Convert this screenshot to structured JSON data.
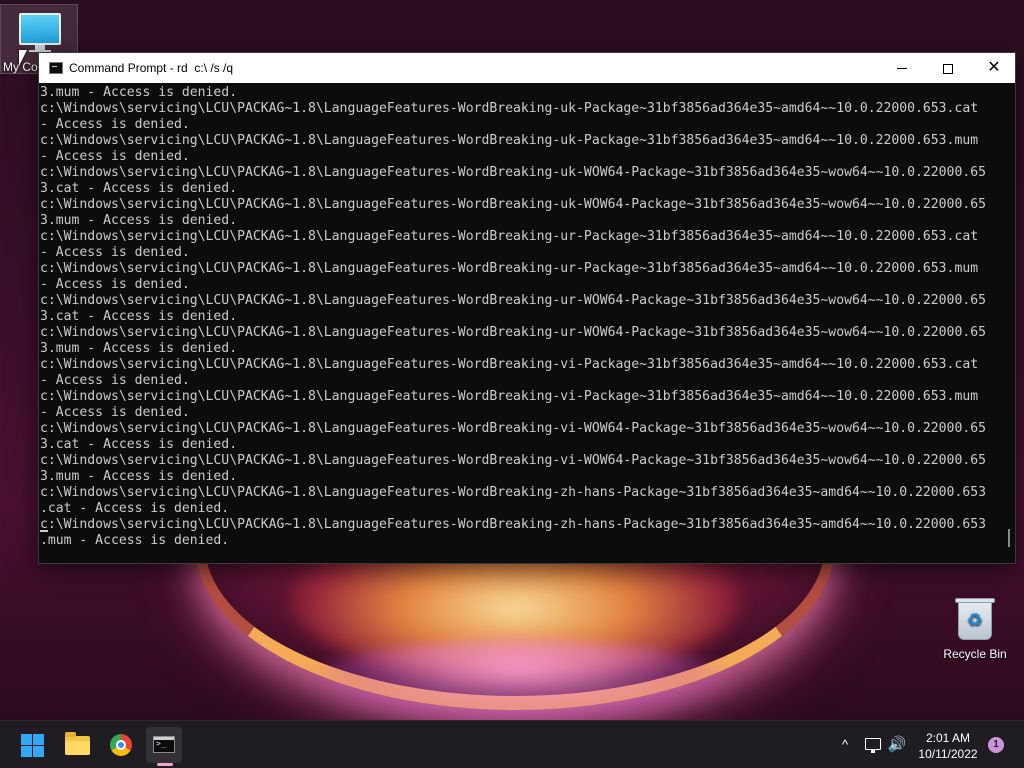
{
  "desktop": {
    "icons": [
      {
        "label": "My Co",
        "icon": "computer-icon"
      },
      {
        "label": "Recycle Bin",
        "icon": "recycle-bin-icon"
      }
    ]
  },
  "window": {
    "title": "Command Prompt - rd  c:\\ /s /q",
    "controls": {
      "minimize": "minimize",
      "maximize": "maximize",
      "close": "close"
    },
    "lines": [
      "3.mum - Access is denied.",
      "c:\\Windows\\servicing\\LCU\\PACKAG~1.8\\LanguageFeatures-WordBreaking-uk-Package~31bf3856ad364e35~amd64~~10.0.22000.653.cat",
      "- Access is denied.",
      "c:\\Windows\\servicing\\LCU\\PACKAG~1.8\\LanguageFeatures-WordBreaking-uk-Package~31bf3856ad364e35~amd64~~10.0.22000.653.mum",
      "- Access is denied.",
      "c:\\Windows\\servicing\\LCU\\PACKAG~1.8\\LanguageFeatures-WordBreaking-uk-WOW64-Package~31bf3856ad364e35~wow64~~10.0.22000.65",
      "3.cat - Access is denied.",
      "c:\\Windows\\servicing\\LCU\\PACKAG~1.8\\LanguageFeatures-WordBreaking-uk-WOW64-Package~31bf3856ad364e35~wow64~~10.0.22000.65",
      "3.mum - Access is denied.",
      "c:\\Windows\\servicing\\LCU\\PACKAG~1.8\\LanguageFeatures-WordBreaking-ur-Package~31bf3856ad364e35~amd64~~10.0.22000.653.cat",
      "- Access is denied.",
      "c:\\Windows\\servicing\\LCU\\PACKAG~1.8\\LanguageFeatures-WordBreaking-ur-Package~31bf3856ad364e35~amd64~~10.0.22000.653.mum",
      "- Access is denied.",
      "c:\\Windows\\servicing\\LCU\\PACKAG~1.8\\LanguageFeatures-WordBreaking-ur-WOW64-Package~31bf3856ad364e35~wow64~~10.0.22000.65",
      "3.cat - Access is denied.",
      "c:\\Windows\\servicing\\LCU\\PACKAG~1.8\\LanguageFeatures-WordBreaking-ur-WOW64-Package~31bf3856ad364e35~wow64~~10.0.22000.65",
      "3.mum - Access is denied.",
      "c:\\Windows\\servicing\\LCU\\PACKAG~1.8\\LanguageFeatures-WordBreaking-vi-Package~31bf3856ad364e35~amd64~~10.0.22000.653.cat",
      "- Access is denied.",
      "c:\\Windows\\servicing\\LCU\\PACKAG~1.8\\LanguageFeatures-WordBreaking-vi-Package~31bf3856ad364e35~amd64~~10.0.22000.653.mum",
      "- Access is denied.",
      "c:\\Windows\\servicing\\LCU\\PACKAG~1.8\\LanguageFeatures-WordBreaking-vi-WOW64-Package~31bf3856ad364e35~wow64~~10.0.22000.65",
      "3.cat - Access is denied.",
      "c:\\Windows\\servicing\\LCU\\PACKAG~1.8\\LanguageFeatures-WordBreaking-vi-WOW64-Package~31bf3856ad364e35~wow64~~10.0.22000.65",
      "3.mum - Access is denied.",
      "c:\\Windows\\servicing\\LCU\\PACKAG~1.8\\LanguageFeatures-WordBreaking-zh-hans-Package~31bf3856ad364e35~amd64~~10.0.22000.653",
      ".cat - Access is denied.",
      "c:\\Windows\\servicing\\LCU\\PACKAG~1.8\\LanguageFeatures-WordBreaking-zh-hans-Package~31bf3856ad364e35~amd64~~10.0.22000.653",
      ".mum - Access is denied."
    ]
  },
  "taskbar": {
    "apps": [
      {
        "name": "Start",
        "icon": "windows-logo-icon"
      },
      {
        "name": "File Explorer",
        "icon": "folder-icon"
      },
      {
        "name": "Google Chrome",
        "icon": "chrome-icon"
      },
      {
        "name": "Command Prompt",
        "icon": "terminal-icon",
        "active": true
      }
    ],
    "tray": {
      "chevron": "^",
      "volume_glyph": "🔊",
      "time": "2:01 AM",
      "date": "10/11/2022",
      "notifications": "1"
    }
  },
  "colors": {
    "console_bg": "#0c0c0c",
    "console_fg": "#cccccc",
    "titlebar_bg": "#ffffff",
    "taskbar_bg": "#1f1d22",
    "accent": "#32a8f5",
    "badge": "#c893d8"
  }
}
